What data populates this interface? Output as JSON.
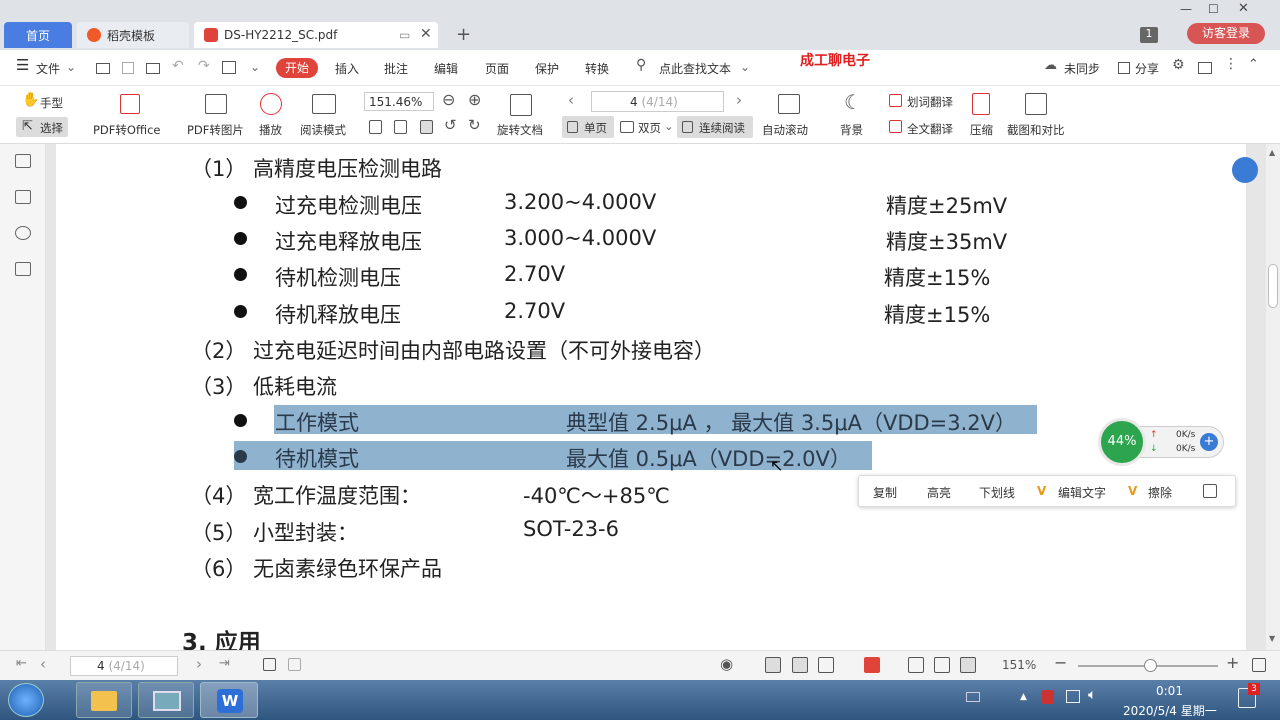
{
  "tabs": {
    "home": "首页",
    "template": "稻壳模板",
    "pdf": "DS-HY2212_SC.pdf",
    "badge_num": "1",
    "guest_login": "访客登录"
  },
  "menu": {
    "file": "文件",
    "start": "开始",
    "insert": "插入",
    "annotate": "批注",
    "edit": "编辑",
    "page": "页面",
    "protect": "保护",
    "convert": "转换",
    "search": "点此查找文本",
    "overlay_title": "成工聊电子",
    "unsynced": "未同步",
    "share": "分享"
  },
  "toolbar": {
    "hand": "手型",
    "select": "选择",
    "pdf_office": "PDF转Office",
    "pdf_image": "PDF转图片",
    "play": "播放",
    "read_mode": "阅读模式",
    "zoom": "151.46%",
    "page_num": "4",
    "page_total": "(4/14)",
    "rotate": "旋转文档",
    "single": "单页",
    "double": "双页",
    "continuous": "连续阅读",
    "auto_scroll": "自动滚动",
    "background": "背景",
    "word_translate": "划词翻译",
    "full_translate": "全文翻译",
    "compress": "压缩",
    "screenshot": "截图和对比"
  },
  "doc": {
    "s1": "（1）  高精度电压检测电路",
    "r1": {
      "name": "过充电检测电压",
      "val": "3.200~4.000V",
      "acc": "精度±25mV"
    },
    "r2": {
      "name": "过充电释放电压",
      "val": "3.000~4.000V",
      "acc": "精度±35mV"
    },
    "r3": {
      "name": "待机检测电压",
      "val": "2.70V",
      "acc": "精度±15%"
    },
    "r4": {
      "name": "待机释放电压",
      "val": "2.70V",
      "acc": "精度±15%"
    },
    "s2": "（2）  过充电延迟时间由内部电路设置（不可外接电容）",
    "s3": "（3）  低耗电流",
    "w1": {
      "name": "工作模式",
      "val": "典型值 2.5μA ， 最大值 3.5μA（VDD=3.2V）"
    },
    "w2": {
      "name": "待机模式",
      "val": "最大值 0.5μA（VDD=2.0V）"
    },
    "s4": {
      "label": "（4）  宽工作温度范围：",
      "val": "-40℃～+85℃"
    },
    "s5": {
      "label": "（5）  小型封装：",
      "val": "SOT-23-6"
    },
    "s6": "（6）  无卤素绿色环保产品",
    "sec3": "3.  应用"
  },
  "popup": {
    "copy": "复制",
    "highlight": "高亮",
    "underline": "下划线",
    "edit_text": "编辑文字",
    "erase": "擦除"
  },
  "net": {
    "pct": "44%",
    "up": "0K/s",
    "down": "0K/s"
  },
  "status": {
    "page_num": "4",
    "page_total": "(4/14)",
    "zoom": "151%"
  },
  "taskbar": {
    "time": "0:01",
    "date": "2020/5/4 星期一",
    "notif": "3"
  },
  "colors": {
    "accent": "#4a7de2",
    "highlight": "#8fb2cf",
    "start_btn": "#e0433a"
  }
}
